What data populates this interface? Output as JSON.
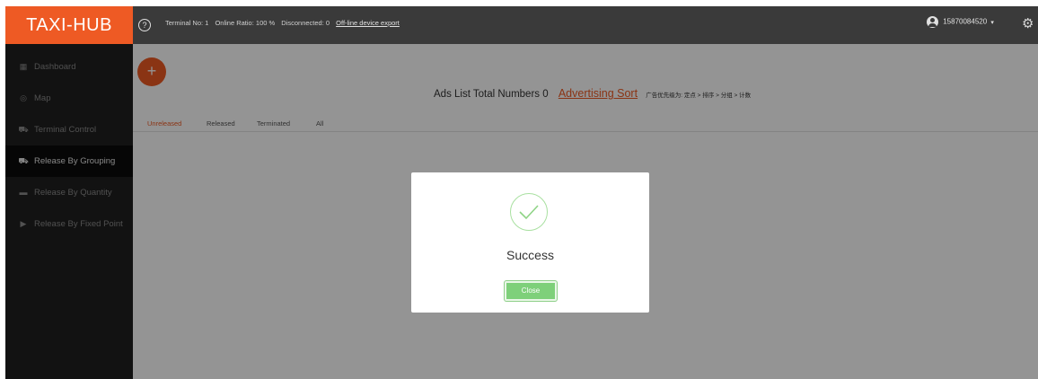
{
  "brand": "TAXI-HUB",
  "header": {
    "help_icon": "question-circle-icon",
    "terminal_no": "Terminal No: 1",
    "online_ratio": "Online Ratio: 100 %",
    "disconnected": "Disconnected: 0",
    "export_link": "Off-line device export",
    "user_phone": "15870084520",
    "user_caret": "▾"
  },
  "sidebar": {
    "items": [
      {
        "label": "Dashboard",
        "icon": "grid-icon"
      },
      {
        "label": "Map",
        "icon": "map-pin-icon"
      },
      {
        "label": "Terminal Control",
        "icon": "car-icon"
      },
      {
        "label": "Release By Grouping",
        "icon": "cars-icon"
      },
      {
        "label": "Release By Quantity",
        "icon": "list-icon"
      },
      {
        "label": "Release By Fixed Point",
        "icon": "play-icon"
      }
    ]
  },
  "main": {
    "add_button": "+",
    "ads_title": "Ads List Total Numbers 0",
    "sort_link": "Advertising Sort",
    "priority_note": "广告优先级为: 定点 > 排序 > 分组 > 计数",
    "tabs": [
      {
        "label": "Unreleased",
        "active": true
      },
      {
        "label": "Released",
        "active": false
      },
      {
        "label": "Terminated",
        "active": false
      },
      {
        "label": "All",
        "active": false
      }
    ]
  },
  "modal": {
    "message": "Success",
    "close_label": "Close"
  },
  "colors": {
    "accent": "#ee5a24",
    "topbar": "#3a3a3a",
    "sidebar": "#1f1f1f",
    "success_green": "#7ed07a"
  }
}
